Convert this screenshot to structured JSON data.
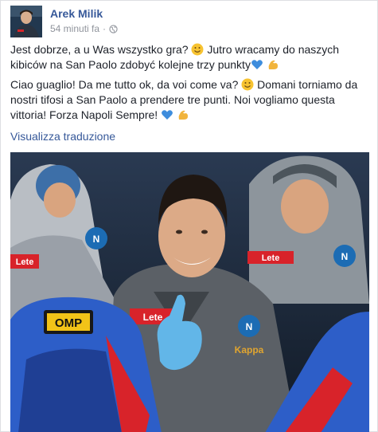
{
  "post": {
    "author": "Arek Milik",
    "timestamp": "54 minuti fa",
    "separator": "·",
    "privacy_icon": "globe-icon",
    "text_pl_1": "Jest dobrze, a u Was wszystko gra?",
    "text_pl_2": "Jutro wracamy do naszych kibiców na San Paolo zdobyć kolejne trzy punkty",
    "text_it_1": "Ciao guaglio! Da me tutto ok, da voi come va?",
    "text_it_2": "Domani torniamo da nostri tifosi a San Paolo a prendere tre punti. Noi vogliamo questa vittoria! Forza Napoli Sempre!",
    "translate_link": "Visualizza traduzione"
  },
  "photo": {
    "jacket_brand": "Kappa",
    "seat_brand": "OMP",
    "sponsor": "Lete"
  },
  "colors": {
    "link": "#365899",
    "meta": "#90949c",
    "text": "#1d2129",
    "napoli_blue": "#1c6cb4",
    "seat_blue": "#2d5ec8",
    "seat_red": "#d8232a"
  }
}
